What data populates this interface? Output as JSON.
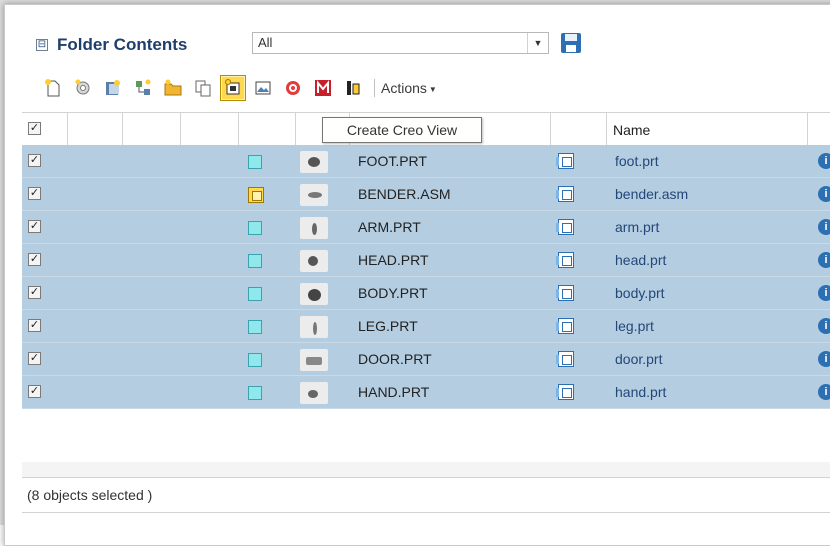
{
  "header": {
    "title": "Folder Contents",
    "collapse_glyph": "⊟",
    "filter_value": "All"
  },
  "toolbar": {
    "actions_label": "Actions",
    "icons": [
      "new-document-icon",
      "gear-icon",
      "import-icon",
      "structure-icon",
      "new-folder-icon",
      "copy-icon",
      "create-creo-view-icon",
      "image-icon",
      "target-icon",
      "m-icon",
      "highlight-icon"
    ],
    "active_icon": "create-creo-view-icon"
  },
  "tooltip": {
    "text": "Create Creo View"
  },
  "table": {
    "columns": {
      "name": "Name"
    },
    "rows": [
      {
        "number": "FOOT.PRT",
        "name": "foot.prt",
        "type": "part"
      },
      {
        "number": "BENDER.ASM",
        "name": "bender.asm",
        "type": "assembly"
      },
      {
        "number": "ARM.PRT",
        "name": "arm.prt",
        "type": "part"
      },
      {
        "number": "HEAD.PRT",
        "name": "head.prt",
        "type": "part"
      },
      {
        "number": "BODY.PRT",
        "name": "body.prt",
        "type": "part"
      },
      {
        "number": "LEG.PRT",
        "name": "leg.prt",
        "type": "part"
      },
      {
        "number": "DOOR.PRT",
        "name": "door.prt",
        "type": "part"
      },
      {
        "number": "HAND.PRT",
        "name": "hand.prt",
        "type": "part"
      }
    ]
  },
  "status": {
    "text": "(8 objects selected )"
  },
  "colors": {
    "selected_row": "#b4cde0",
    "title": "#1f3e6b",
    "link": "#24477a"
  }
}
